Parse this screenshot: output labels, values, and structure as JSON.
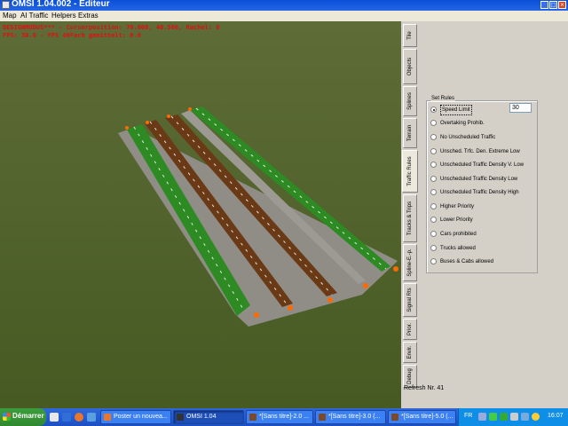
{
  "window": {
    "title": "OMSI 1.04.002 - Editeur"
  },
  "menu": [
    "Map",
    "AI Traffic",
    "Helpers",
    "Extras"
  ],
  "hud": {
    "line1": "DESIGNMODUS*** - Cursorposition: 70.000, 40.506, Rachel: 0",
    "line2": "FPS: 30.0 - FPS 40Fach gemittelt: 0.0"
  },
  "tabs": [
    "Tile",
    "Objects",
    "Splines",
    "Terrain",
    "Traffic Rules",
    "Tracks & Trips",
    "Spline-E.-p.",
    "Signal Rts",
    "Prior.",
    "Envir.",
    "Debug"
  ],
  "active_tab": "Traffic Rules",
  "set_rules": {
    "legend": "Set Rules",
    "speed_value": "30",
    "selected": "Speed Limit",
    "options": [
      "Speed Limit",
      "Overtaking Prohib.",
      "No Unscheduled Traffic",
      "Unsched. Trfc. Den. Extreme Low",
      "Unscheduled Traffic Density V. Low",
      "Unscheduled Traffic Density Low",
      "Unscheduled Traffic Density High",
      "Higher Priority",
      "Lower Priority",
      "Cars prohibited",
      "Trucks allowed",
      "Buses & Cabs allowed"
    ]
  },
  "refresh": "Refresh Nr. 41",
  "taskbar": {
    "start_label": "Démarrer",
    "tasks": [
      {
        "label": "Poster un nouvea...",
        "color": "#e8762c"
      },
      {
        "label": "OMSI 1.04",
        "color": "#333333"
      },
      {
        "label": "*[Sans titre]-2.0 ...",
        "color": "#7a4a2a"
      },
      {
        "label": "*[Sans titre]-3.0 (...",
        "color": "#7a4a2a"
      },
      {
        "label": "*[Sans titre]-5.0 (...",
        "color": "#7a4a2a"
      }
    ],
    "lang": "FR",
    "clock": "16:07"
  },
  "colors": {
    "grass": "#4f5f2c",
    "asphalt": "#9c9a92",
    "lane_brown": "#6a3a16",
    "lane_green": "#2e8a22"
  }
}
